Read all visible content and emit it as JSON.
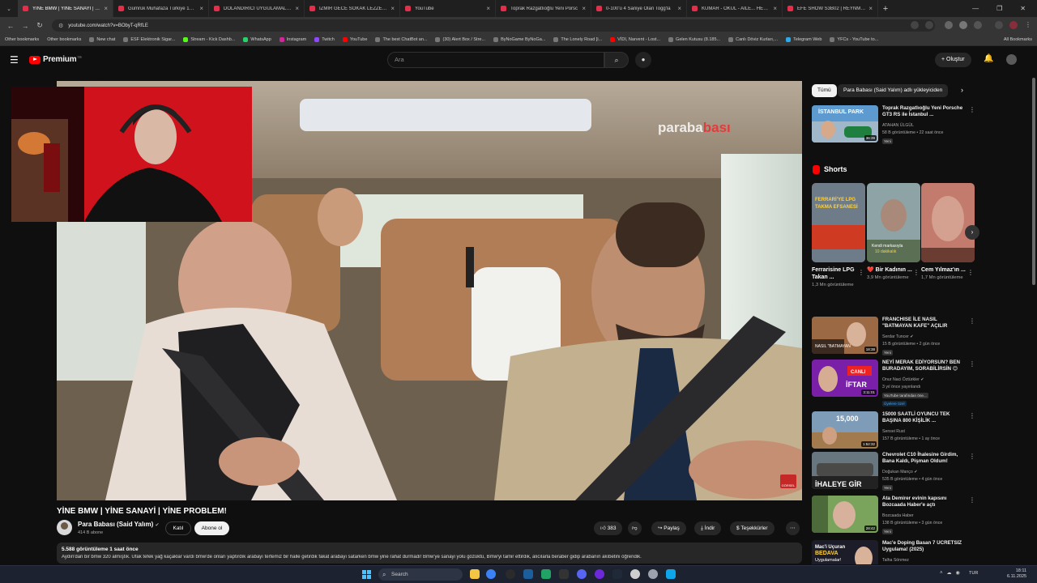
{
  "browser": {
    "tabs": [
      {
        "label": "YİNE BMW | YİNE SANAYİ | YİNE",
        "active": true
      },
      {
        "label": "Gümrük Muhafaza Türkiye 18. N"
      },
      {
        "label": "DOLANDIRICI UYGULAMALAR"
      },
      {
        "label": "İZMİR GECE SOKAK LEZZETLERİ"
      },
      {
        "label": "YouTube"
      },
      {
        "label": "Toprak Razgatlıoğlu Yeni Porsc"
      },
      {
        "label": "0-100'ü 4 Saniye Olan Togg'la"
      },
      {
        "label": "KUMAR - OKUL - AİLE... HEPSİ"
      },
      {
        "label": "EFE SHOW S3B02 | REYNMEN"
      }
    ],
    "new_tab": "+",
    "window_controls": [
      "—",
      "❐",
      "✕"
    ],
    "url": "youtube.com/watch?v=BObyT-qRfLE",
    "bookmarks": [
      "Other bookmarks",
      "Other bookmarks",
      "New chat",
      "ESF Elektronik Sigar...",
      "Stream - Kick Dashb...",
      "WhatsApp",
      "Instagram",
      "Twitch",
      "YouTube",
      "The best ChatBot an...",
      "(30) Alert Box / Stre...",
      "ByNoGame ByNoGa...",
      "The Lonely Road [i...",
      "VİDI, Narvent - Lost...",
      "Gelen Kutusu (8.185...",
      "Canlı Döviz Kurları,...",
      "Telegram Web",
      "YFCs - YouTube to..."
    ],
    "all_bookmarks": "All Bookmarks"
  },
  "header": {
    "logo_text": "Premium",
    "logo_tm": "TR",
    "search_placeholder": "Ara",
    "create_label": "+  Oluştur"
  },
  "player": {
    "watermark_part1": "paraba",
    "watermark_part2": "bası",
    "corner_label": "GÖRSEL"
  },
  "video": {
    "title": "YİNE BMW | YİNE SANAYİ | YİNE PROBLEM!",
    "channel": "Para Babası (Said Yalım)",
    "verified": "✔",
    "subscribers": "414 B abone",
    "join": "Katıl",
    "subscribe": "Abone ol",
    "likes": "383",
    "share": "Paylaş",
    "download": "İndir",
    "thanks": "Teşekkürler",
    "more": "⋯",
    "stats": "5.588 görüntüleme  1 saat önce",
    "description": "Aydın'dan bir bmw 320 almıştık. Ufak tefek yağ kaçaklar vardı bmw'de onları yaptırdık arabayı tertemiz bir halle getirdik fakat arabayı satarken bmw yine rahat durmadı! Bmw'ye sanayi yolu gözüktü, Bmw'yi tamir ettirdik, alıcılarla beraber gidip arabanın akıbetini öğrendik."
  },
  "sidebar": {
    "chips": [
      "Tümü",
      "Para Babası (Said Yalım) adlı yükleyiciden"
    ],
    "top_rec": {
      "title": "Toprak Razgatlıoğlu Yeni Porsche GT3 RS ile İstanbul ...",
      "channel": "ATAHAN ÜLGÜL",
      "meta": "58 B görüntüleme • 22 saat önce",
      "badge": "Yeni",
      "duration": "36:39"
    },
    "shorts_title": "Shorts",
    "shorts": [
      {
        "title": "Ferrarisine LPG Takan ...",
        "views": "1,3 Mn görüntüleme",
        "thumb_text": "FERRARİ'YE LPG TAKMA EFSANESİ"
      },
      {
        "title": "❤️ Bir Kadının ...",
        "views": "3,9 Mn görüntüleme",
        "thumb_text": "Kendi markasıyla 10 dakikalık"
      },
      {
        "title": "Cem Yılmaz'ın ...",
        "views": "1,7 Mn görüntüleme",
        "thumb_text": ""
      }
    ],
    "recs": [
      {
        "title": "FRANCHISE İLE NASIL \"BATMAYAN KAFE\" AÇILIR",
        "channel": "Serdar Tuncer ✔",
        "meta": "15 B görüntüleme • 2 gün önce",
        "badge": "Yeni",
        "duration": "18:38"
      },
      {
        "title": "NEYİ MERAK EDİYORSUN? BEN BURADAYIM, SORABİLİRSİN 😊",
        "channel": "Onur Naci Öztürkler ✔",
        "meta": "3 yıl önce yayınlandı",
        "badge": "YouTube tarafından öne...",
        "badge2": "Üyelere özel",
        "duration": "3:11:01"
      },
      {
        "title": "15000 SAATLİ OYUNCU TEK BAŞINA 800 KİŞİLİK ...",
        "channel": "Sensei Rust",
        "meta": "157 B görüntüleme • 1 ay önce",
        "duration": "1:52:32",
        "thumb_text": "15,000"
      },
      {
        "title": "Chevrolet C10 İhalesine Girdim, Bana Kaldı, Pişman Oldum!",
        "channel": "Doğukan Manço ✔",
        "meta": "535 B görüntüleme • 4 gün önce",
        "badge": "Yeni",
        "duration": "",
        "thumb_text": "İHALEYE GİR"
      },
      {
        "title": "Ata Demirer evinin kapısını Bozcaada Haber'e açtı",
        "channel": "Bozcaada Haber",
        "meta": "138 B görüntüleme • 3 gün önce",
        "badge": "Yeni",
        "duration": "28:42"
      },
      {
        "title": "Mac'e Doping Basan 7 ÜCRETSİZ Uygulama! (2025)",
        "channel": "Talha Sönmez",
        "meta": "",
        "duration": "",
        "thumb_text": "Mac'i Uçuran BEDAVA Uygulamalar!"
      }
    ]
  },
  "taskbar": {
    "search": "Search",
    "lang": "TUR",
    "time": "18:11",
    "date": "6.11.2025"
  }
}
